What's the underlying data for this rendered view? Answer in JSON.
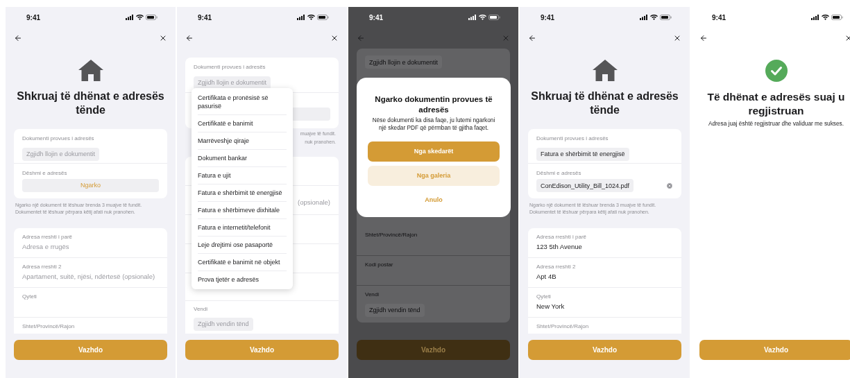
{
  "screens": [
    {
      "kind": "form",
      "dimmed": false,
      "time": "9:41",
      "title": "Shkruaj të dhënat e adresës tënde",
      "document_type": {
        "label": "Dokumenti provues i adresës",
        "placeholder": "Zgjidh llojin e dokumentit"
      },
      "proof": {
        "label": "Dëshmi e adresës",
        "upload_button": "Ngarko"
      },
      "hint": "Ngarko një dokument të lëshuar brenda 3 muajve të fundit. Dokumentet të lëshuar përpara këtij afati nuk pranohen.",
      "address_fields": [
        {
          "label": "Adresa rreshti i parë",
          "placeholder": "Adresa e rrugës"
        },
        {
          "label": "Adresa rreshti 2",
          "placeholder": "Apartament, suitë, njësi, ndërtesë (opsionale)"
        },
        {
          "label": "Qyteti"
        },
        {
          "label": "Shtet/Provincë/Rajon"
        }
      ],
      "continue_button": "Vazhdo"
    },
    {
      "kind": "dropdown",
      "dimmed": false,
      "time": "9:41",
      "document_type": {
        "label": "Dokumenti provues i adresës",
        "placeholder": "Zgjidh llojin e dokumentit"
      },
      "hint_fragments": [
        "muajve të fundit.",
        "nuk pranohen."
      ],
      "optional_fragment": "(opsionale)",
      "country": {
        "label": "Vendi",
        "placeholder": "Zgjidh vendin tënd"
      },
      "options": [
        {
          "label": "Certifikata e pronësisë së pasurisë",
          "selected": false
        },
        {
          "label": "Certifikatë e banimit",
          "selected": false
        },
        {
          "label": "Marrëveshje qiraje",
          "selected": false
        },
        {
          "label": "Dokument bankar",
          "selected": false
        },
        {
          "label": "Fatura e ujit",
          "selected": false
        },
        {
          "label": "Fatura e shërbimit të energjisë",
          "selected": false
        },
        {
          "label": "Fatura e shërbimeve dixhitale",
          "selected": false
        },
        {
          "label": "Fatura e internetit/telefonit",
          "selected": false
        },
        {
          "label": "Leje drejtimi ose pasaportë",
          "selected": false
        },
        {
          "label": "Certifikatë e banimit në objekt",
          "selected": false
        },
        {
          "label": "Prova tjetër e adresës",
          "selected": false
        }
      ],
      "continue_button": "Vazhdo"
    },
    {
      "kind": "dialog",
      "dimmed": true,
      "time": "9:41",
      "document_type": {
        "placeholder": "Zgjidh llojin e dokumentit"
      },
      "address_fields": [
        {
          "label": "Shtet/Provincë/Rajon"
        },
        {
          "label": "Kodi postar"
        }
      ],
      "country": {
        "label": "Vendi",
        "placeholder": "Zgjidh vendin tënd"
      },
      "dialog": {
        "title": "Ngarko dokumentin provues të adresës",
        "message": "Nëse dokumenti ka disa faqe, ju lutemi ngarkoni një skedar PDF që përmban të gjitha faqet.",
        "buttons": [
          {
            "kind": "primary",
            "label": "Nga skedarët"
          },
          {
            "kind": "secondary",
            "label": "Nga galeria"
          },
          {
            "kind": "text",
            "label": "Anulo"
          }
        ]
      },
      "continue_button": "Vazhdo"
    },
    {
      "kind": "form",
      "dimmed": false,
      "time": "9:41",
      "title": "Shkruaj të dhënat e adresës tënde",
      "document_type": {
        "label": "Dokumenti provues i adresës",
        "value": "Fatura e shërbimit të energjisë"
      },
      "proof": {
        "label": "Dëshmi e adresës",
        "file": "ConEdison_Utility_Bill_1024.pdf"
      },
      "hint": "Ngarko një dokument të lëshuar brenda 3 muajve të fundit. Dokumentet të lëshuar përpara këtij afati nuk pranohen.",
      "address_fields": [
        {
          "label": "Adresa rreshti i parë",
          "value": "123 5th Avenue"
        },
        {
          "label": "Adresa rreshti 2",
          "value": "Apt 4B"
        },
        {
          "label": "Qyteti",
          "value": "New York"
        },
        {
          "label": "Shtet/Provincë/Rajon"
        }
      ],
      "continue_button": "Vazhdo"
    },
    {
      "kind": "success",
      "dimmed": false,
      "time": "9:41",
      "title": "Të dhënat e adresës suaj u regjistruan",
      "message": "Adresa juaj është regjistruar dhe validuar me sukses.",
      "continue_button": "Vazhdo"
    }
  ]
}
